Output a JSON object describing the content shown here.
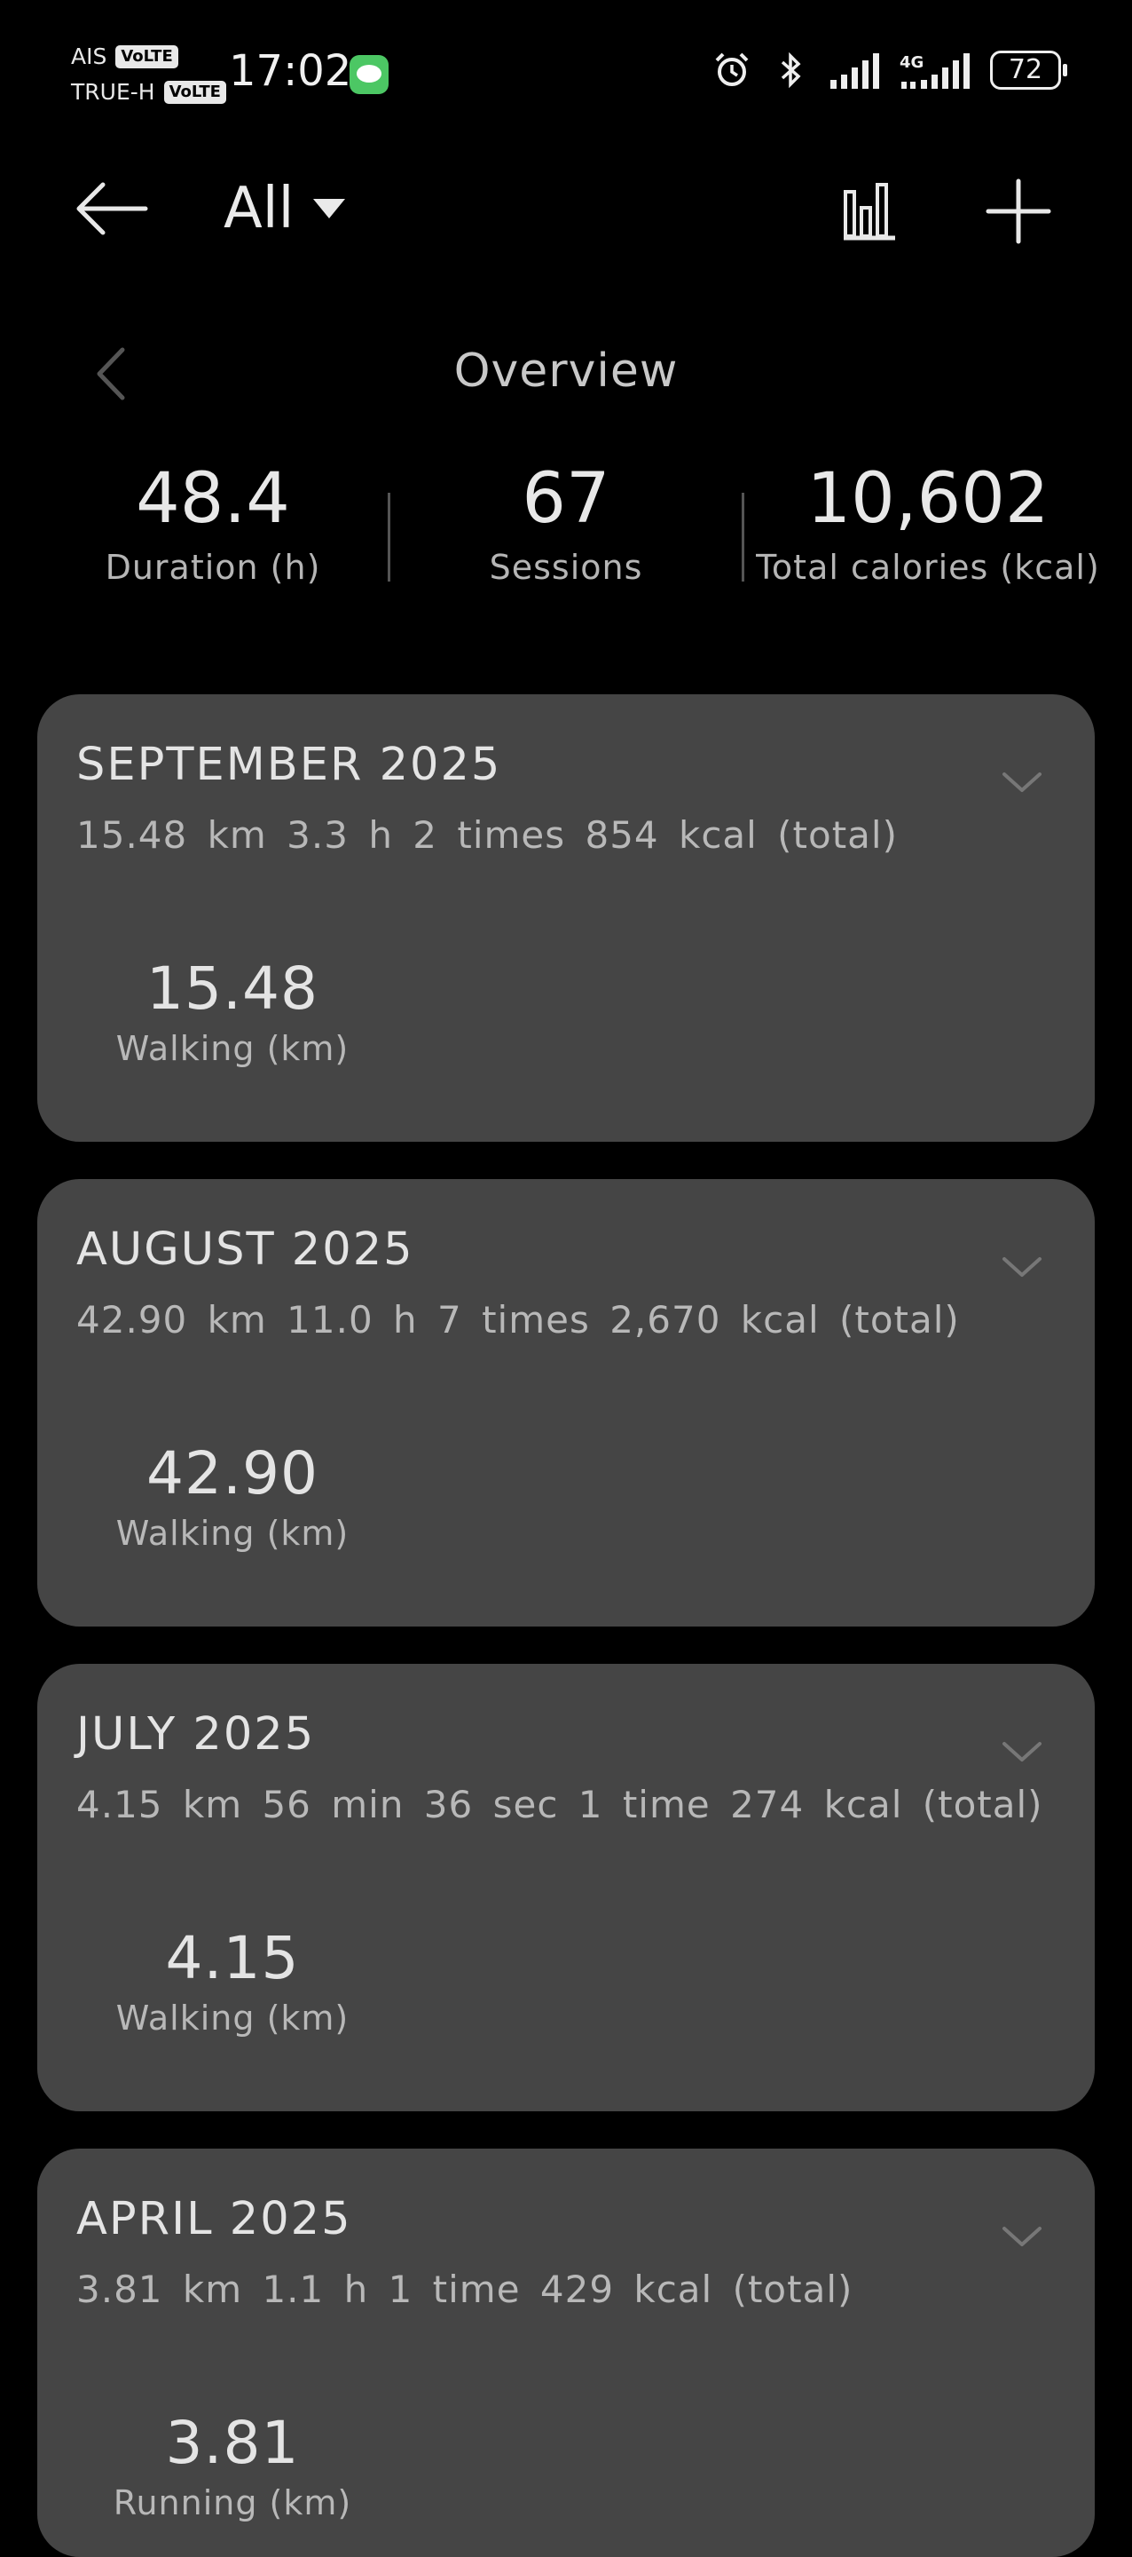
{
  "status_bar": {
    "carrier1": "AIS",
    "carrier2": "TRUE-H",
    "volte": "VoLTE",
    "time": "17:02",
    "network": "4G",
    "battery": "72",
    "icons": [
      "line-app-icon",
      "alarm-icon",
      "bluetooth-icon",
      "signal-icon",
      "signal-4g-icon",
      "battery-icon"
    ]
  },
  "toolbar": {
    "filter_label": "All",
    "icons": [
      "back-arrow-icon",
      "dropdown-triangle-icon",
      "bar-chart-icon",
      "add-icon"
    ]
  },
  "overview": {
    "title": "Overview",
    "stats": [
      {
        "value": "48.4",
        "label": "Duration (h)"
      },
      {
        "value": "67",
        "label": "Sessions"
      },
      {
        "value": "10,602",
        "label": "Total calories (kcal)"
      }
    ]
  },
  "months": [
    {
      "title": "SEPTEMBER 2025",
      "summary": "15.48 km 3.3 h 2 times 854 kcal (total)",
      "metric_value": "15.48",
      "metric_label": "Walking (km)"
    },
    {
      "title": "AUGUST 2025",
      "summary": "42.90 km 11.0 h 7 times 2,670 kcal (total)",
      "metric_value": "42.90",
      "metric_label": "Walking (km)"
    },
    {
      "title": "JULY 2025",
      "summary": "4.15 km 56 min 36 sec 1 time 274 kcal (total)",
      "metric_value": "4.15",
      "metric_label": "Walking (km)"
    },
    {
      "title": "APRIL 2025",
      "summary": "3.81 km 1.1 h 1 time 429 kcal (total)",
      "metric_value": "3.81",
      "metric_label": "Running (km)"
    }
  ],
  "colors": {
    "background": "#000000",
    "card": "#454545",
    "text": "#e6e6e6",
    "muted": "#b8b8b8",
    "line_green": "#4cc764"
  }
}
